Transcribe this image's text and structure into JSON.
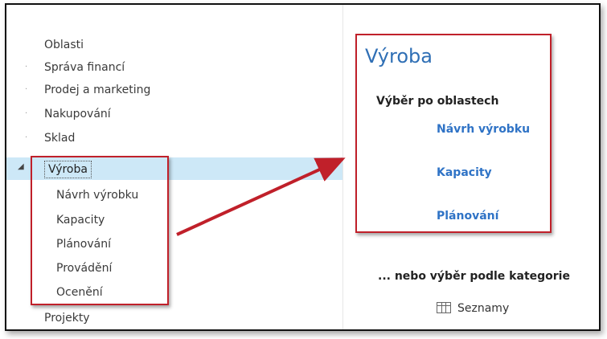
{
  "navigation": {
    "items": [
      {
        "label": "Oblasti"
      },
      {
        "label": "Správa financí"
      },
      {
        "label": "Prodej a marketing"
      },
      {
        "label": "Nakupování"
      },
      {
        "label": "Sklad"
      }
    ],
    "selected": {
      "label": "Výroba",
      "children": [
        {
          "label": "Návrh výrobku"
        },
        {
          "label": "Kapacity"
        },
        {
          "label": "Plánování"
        },
        {
          "label": "Provádění"
        },
        {
          "label": "Ocenění"
        }
      ]
    },
    "after_selected": {
      "label": "Projekty"
    }
  },
  "detail": {
    "title": "Výroba",
    "group_heading": "Výběr po oblastech",
    "links": [
      {
        "label": "Návrh výrobku"
      },
      {
        "label": "Kapacity"
      },
      {
        "label": "Plánování"
      }
    ],
    "category_heading": "... nebo výběr podle kategorie",
    "category_items": [
      {
        "label": "Seznamy",
        "icon": "table-grid-icon"
      }
    ]
  },
  "colors": {
    "accent": "#2f73c6",
    "selection": "#cde8f7",
    "callout": "#c0202a"
  }
}
